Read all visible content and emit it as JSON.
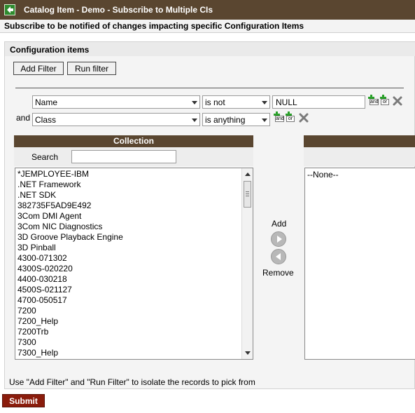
{
  "window": {
    "title": "Catalog Item - Demo - Subscribe to Multiple CIs",
    "subtitle": "Subscribe to be notified of changes impacting specific Configuration Items"
  },
  "section": {
    "title": "Configuration items",
    "add_filter_label": "Add Filter",
    "run_filter_label": "Run filter"
  },
  "conditions": [
    {
      "field": "Name",
      "operator": "is not",
      "value": "NULL"
    },
    {
      "conjunction": "and",
      "field": "Class",
      "operator": "is anything"
    }
  ],
  "andor": {
    "and_label": "and",
    "or_label": "or"
  },
  "collection": {
    "header": "Collection",
    "search_label": "Search",
    "search_value": "",
    "items": [
      "*JEMPLOYEE-IBM",
      ".NET Framework",
      ".NET SDK",
      "382735F5AD9E492",
      "3Com DMI Agent",
      "3Com NIC Diagnostics",
      "3D Groove Playback Engine",
      "3D Pinball",
      "4300-071302",
      "4300S-020220",
      "4400-030218",
      "4500S-021127",
      "4700-050517",
      "7200",
      "7200_Help",
      "7200Trb",
      "7300",
      "7300_Help"
    ]
  },
  "slushbucket": {
    "add_label": "Add",
    "remove_label": "Remove"
  },
  "selected": {
    "items": [
      "--None--"
    ]
  },
  "hint": "Use \"Add Filter\" and \"Run Filter\" to isolate the records to pick from",
  "submit_label": "Submit",
  "colors": {
    "header_brown": "#5a4630",
    "submit_red": "#8a1c0c",
    "back_green": "#2e8b2e"
  },
  "icons": {
    "back": "back-arrow-icon",
    "add_condition": "and-or-icon",
    "delete": "delete-x-icon",
    "add_arrow": "right-arrow-icon",
    "remove_arrow": "left-arrow-icon"
  }
}
